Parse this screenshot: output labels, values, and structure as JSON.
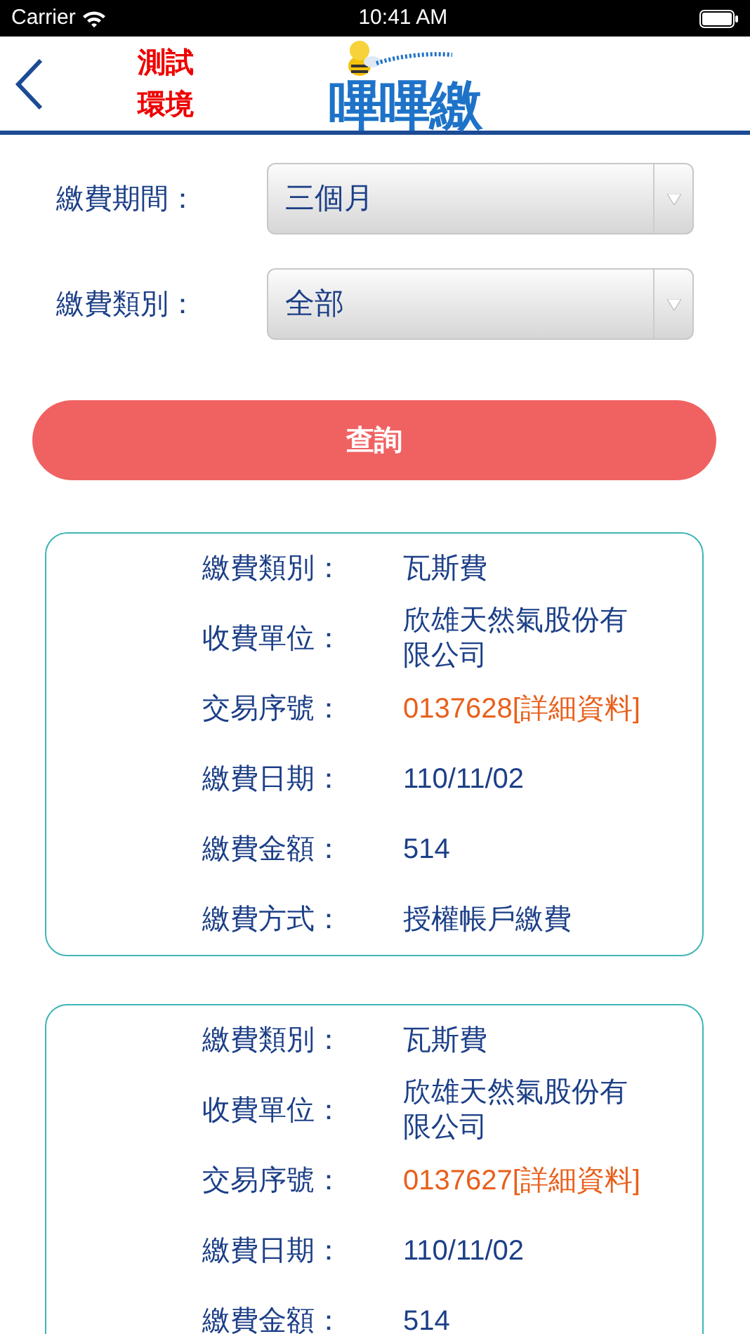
{
  "status_bar": {
    "carrier": "Carrier",
    "time": "10:41 AM"
  },
  "header": {
    "env_label": [
      "測試",
      "環境"
    ],
    "logo_text": "嗶嗶繳"
  },
  "filters": [
    {
      "label": "繳費期間：",
      "value": "三個月"
    },
    {
      "label": "繳費類別：",
      "value": "全部"
    }
  ],
  "query_button": "查詢",
  "records": [
    {
      "fields": [
        {
          "label": "繳費類別：",
          "value": "瓦斯費",
          "kind": "text"
        },
        {
          "label": "收費單位：",
          "value": "欣雄天然氣股份有限公司",
          "kind": "text"
        },
        {
          "label": "交易序號：",
          "value": "0137628[詳細資料]",
          "kind": "link"
        },
        {
          "label": "繳費日期：",
          "value": "110/11/02",
          "kind": "text"
        },
        {
          "label": "繳費金額：",
          "value": "514",
          "kind": "text"
        },
        {
          "label": "繳費方式：",
          "value": "授權帳戶繳費",
          "kind": "text"
        }
      ]
    },
    {
      "fields": [
        {
          "label": "繳費類別：",
          "value": "瓦斯費",
          "kind": "text"
        },
        {
          "label": "收費單位：",
          "value": "欣雄天然氣股份有限公司",
          "kind": "text"
        },
        {
          "label": "交易序號：",
          "value": "0137627[詳細資料]",
          "kind": "link"
        },
        {
          "label": "繳費日期：",
          "value": "110/11/02",
          "kind": "text"
        },
        {
          "label": "繳費金額：",
          "value": "514",
          "kind": "text"
        }
      ]
    }
  ]
}
